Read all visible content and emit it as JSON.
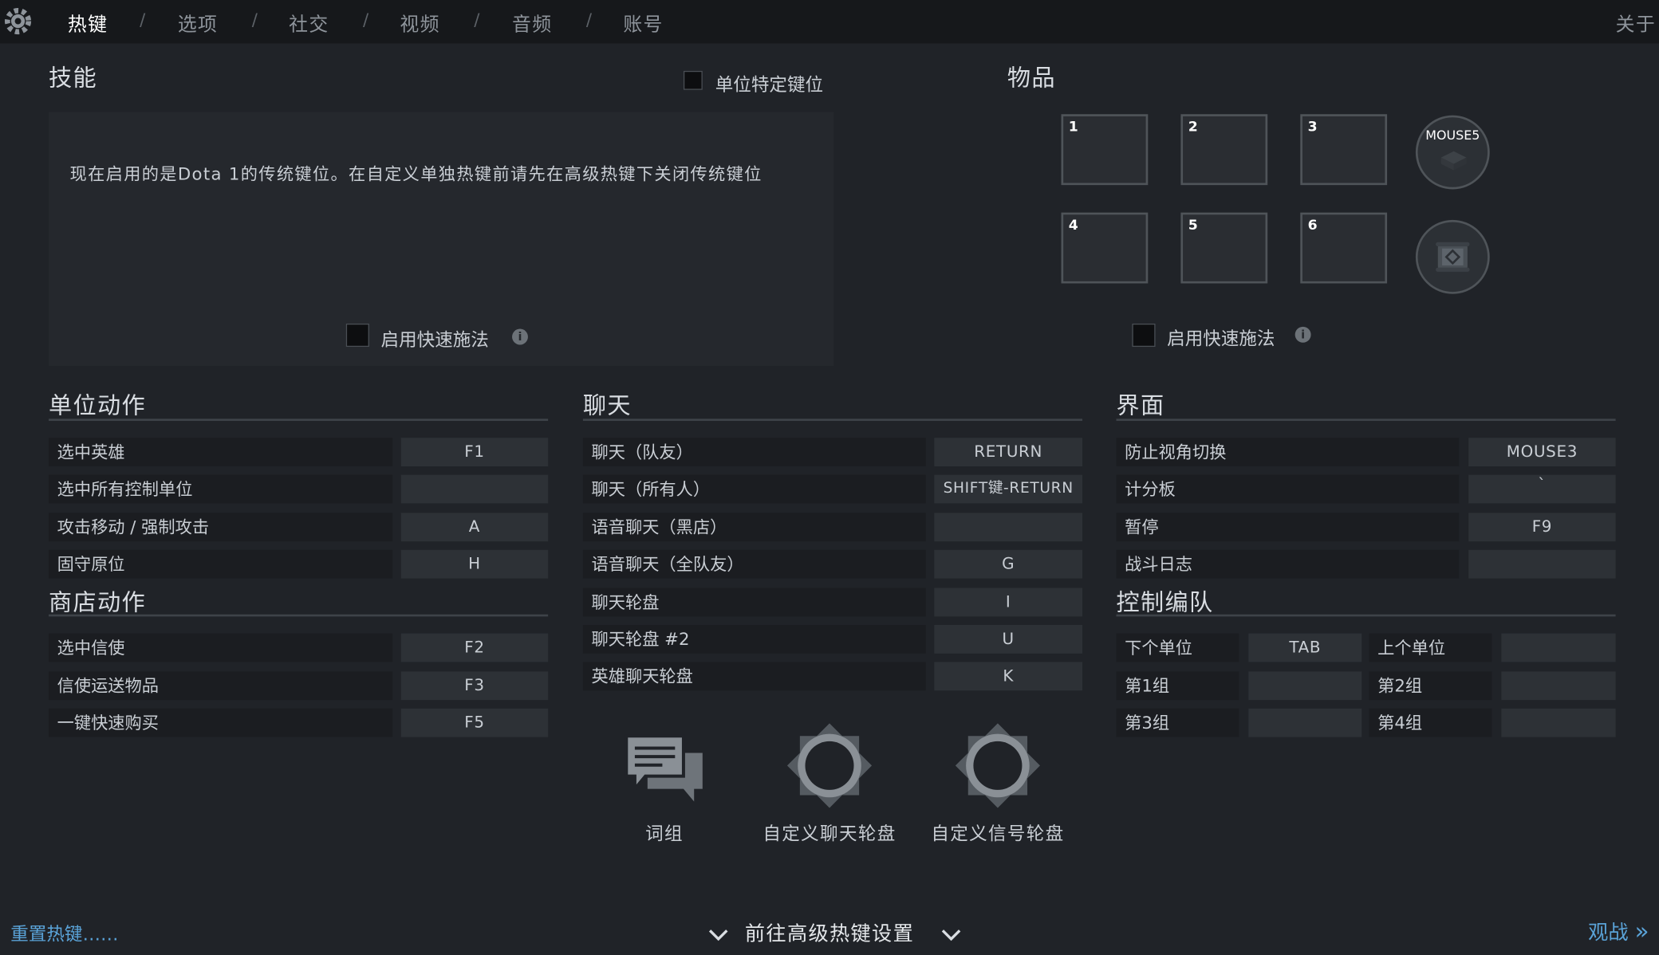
{
  "nav": {
    "tabs": [
      "热键",
      "选项",
      "社交",
      "视频",
      "音频",
      "账号"
    ],
    "separator": "/",
    "about": "关于"
  },
  "skills": {
    "title": "技能",
    "unit_specific_label": "单位特定键位",
    "notice": "现在启用的是Dota 1的传统键位。在自定义单独热键前请先在高级热键下关闭传统键位",
    "quickcast_label": "启用快速施法",
    "info_glyph": "i"
  },
  "items": {
    "title": "物品",
    "slots": [
      "1",
      "2",
      "3",
      "4",
      "5",
      "6"
    ],
    "neutral_key": "MOUSE5",
    "quickcast_label": "启用快速施法",
    "info_glyph": "i"
  },
  "unit_actions": {
    "title": "单位动作",
    "rows": [
      {
        "label": "选中英雄",
        "key": "F1"
      },
      {
        "label": "选中所有控制单位",
        "key": ""
      },
      {
        "label": "攻击移动 / 强制攻击",
        "key": "A"
      },
      {
        "label": "固守原位",
        "key": "H"
      }
    ]
  },
  "shop_actions": {
    "title": "商店动作",
    "rows": [
      {
        "label": "选中信使",
        "key": "F2"
      },
      {
        "label": "信使运送物品",
        "key": "F3"
      },
      {
        "label": "一键快速购买",
        "key": "F5"
      }
    ]
  },
  "chat": {
    "title": "聊天",
    "rows": [
      {
        "label": "聊天（队友）",
        "key": "RETURN"
      },
      {
        "label": "聊天（所有人）",
        "key": "SHIFT键-RETURN"
      },
      {
        "label": "语音聊天（黑店）",
        "key": ""
      },
      {
        "label": "语音聊天（全队友）",
        "key": "G"
      },
      {
        "label": "聊天轮盘",
        "key": "I"
      },
      {
        "label": "聊天轮盘 #2",
        "key": "U"
      },
      {
        "label": "英雄聊天轮盘",
        "key": "K"
      }
    ],
    "wheels": [
      "词组",
      "自定义聊天轮盘",
      "自定义信号轮盘"
    ]
  },
  "interface": {
    "title": "界面",
    "rows": [
      {
        "label": "防止视角切换",
        "key": "MOUSE3"
      },
      {
        "label": "计分板",
        "key": "`"
      },
      {
        "label": "暂停",
        "key": "F9"
      },
      {
        "label": "战斗日志",
        "key": ""
      }
    ]
  },
  "control_groups": {
    "title": "控制编队",
    "rows": [
      {
        "left_label": "下个单位",
        "left_key": "TAB",
        "right_label": "上个单位",
        "right_key": ""
      },
      {
        "left_label": "第1组",
        "left_key": "",
        "right_label": "第2组",
        "right_key": ""
      },
      {
        "left_label": "第3组",
        "left_key": "",
        "right_label": "第4组",
        "right_key": ""
      }
    ]
  },
  "footer": {
    "reset": "重置热键……",
    "advanced": "前往高级热键设置",
    "spectate": "观战",
    "spectate_arrow": "»"
  },
  "colors": {
    "background": "#202328",
    "link": "#5aa3d8"
  }
}
